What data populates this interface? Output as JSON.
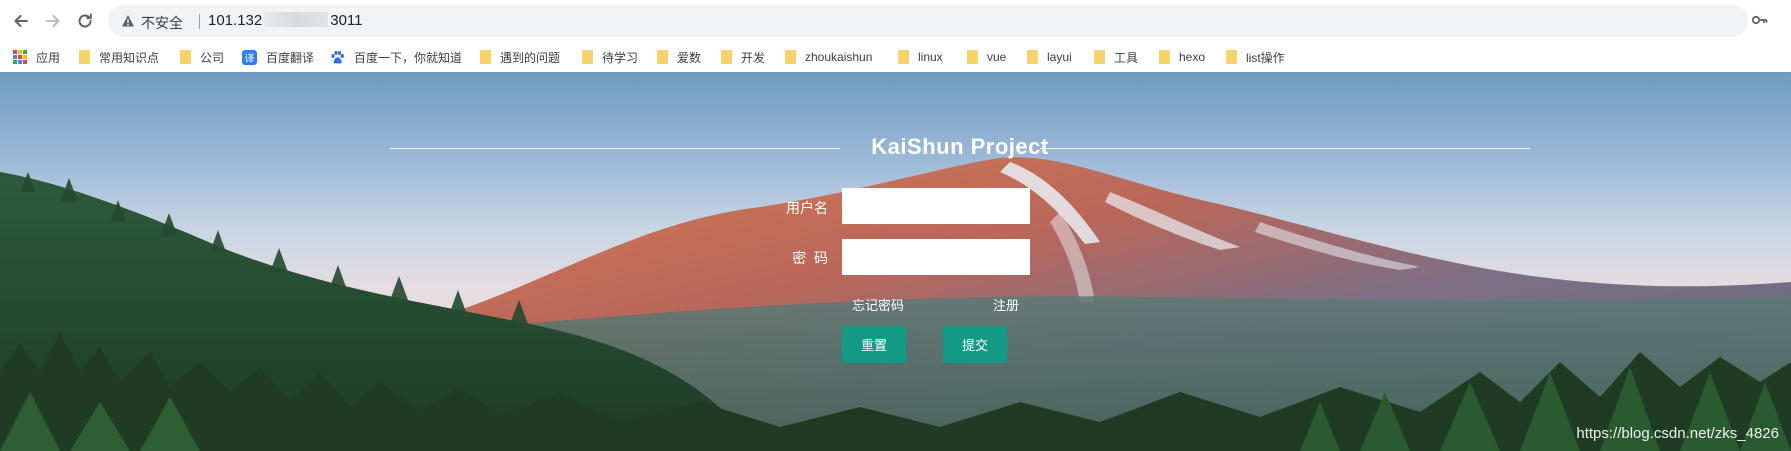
{
  "browser": {
    "security_label": "不安全",
    "url_prefix": "101.132",
    "url_suffix": "3011"
  },
  "bookmarks": [
    {
      "label": "应用",
      "icon": "apps-grid-icon"
    },
    {
      "label": "常用知识点",
      "icon": "folder-icon"
    },
    {
      "label": "公司",
      "icon": "folder-icon"
    },
    {
      "label": "百度翻译",
      "icon": "translate-icon",
      "icon_glyph": "译"
    },
    {
      "label": "百度一下，你就知道",
      "icon": "baidu-paw-icon"
    },
    {
      "label": "遇到的问题",
      "icon": "folder-icon"
    },
    {
      "label": "待学习",
      "icon": "folder-icon"
    },
    {
      "label": "爱数",
      "icon": "folder-icon"
    },
    {
      "label": "开发",
      "icon": "folder-icon"
    },
    {
      "label": "zhoukaishun",
      "icon": "folder-icon"
    },
    {
      "label": "linux",
      "icon": "folder-icon"
    },
    {
      "label": "vue",
      "icon": "folder-icon"
    },
    {
      "label": "layui",
      "icon": "folder-icon"
    },
    {
      "label": "工具",
      "icon": "folder-icon"
    },
    {
      "label": "hexo",
      "icon": "folder-icon"
    },
    {
      "label": "list操作",
      "icon": "folder-icon"
    }
  ],
  "login": {
    "title": "KaiShun Project",
    "username_label": "用户名",
    "username_value": "",
    "password_label": "密  码",
    "password_value": "",
    "forgot_link": "忘记密码",
    "register_link": "注册",
    "reset_button": "重置",
    "submit_button": "提交"
  },
  "watermark": "https://blog.csdn.net/zks_4826",
  "colors": {
    "button": "#139a87",
    "folder": "#f5d369",
    "translate_icon": "#2a7ff5"
  }
}
